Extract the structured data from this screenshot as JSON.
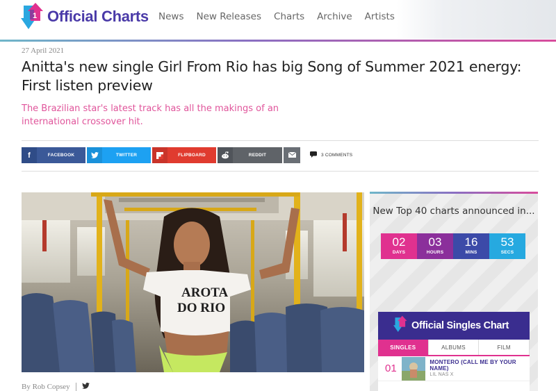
{
  "header": {
    "logo_text": "Official Charts",
    "nav": [
      "News",
      "New Releases",
      "Charts",
      "Archive",
      "Artists"
    ]
  },
  "article": {
    "date": "27 April 2021",
    "headline": "Anitta's new single Girl From Rio has big Song of Summer 2021 energy: First listen preview",
    "standfirst": "The Brazilian star's latest track has all the makings of an international crossover hit.",
    "byline": "By Rob Copsey"
  },
  "share": {
    "facebook": "FACEBOOK",
    "twitter": "TWITTER",
    "flipboard": "FLIPBOARD",
    "reddit": "REDDIT",
    "comments": "3 COMMENTS"
  },
  "hero": {
    "shirt_text_line1": "AROTA",
    "shirt_text_line2": "DO RIO"
  },
  "sidebar": {
    "countdown_title": "New Top 40 charts announced in...",
    "timer": [
      {
        "value": "02",
        "unit": "DAYS"
      },
      {
        "value": "03",
        "unit": "HOURS"
      },
      {
        "value": "16",
        "unit": "MINS"
      },
      {
        "value": "53",
        "unit": "SECS"
      }
    ],
    "chart_title": "Official Singles Chart",
    "tabs": [
      "SINGLES",
      "ALBUMS",
      "FILM"
    ],
    "entries": [
      {
        "position": "01",
        "title": "MONTERO (CALL ME BY YOUR NAME)",
        "artist": "LIL NAS X"
      }
    ]
  },
  "colors": {
    "brand_purple": "#4a3aa8",
    "brand_pink": "#e0318f",
    "standfirst_pink": "#e0559b",
    "facebook": "#3b5998",
    "twitter": "#1da1f2",
    "flipboard": "#e03b2f",
    "reddit": "#5f6368"
  }
}
